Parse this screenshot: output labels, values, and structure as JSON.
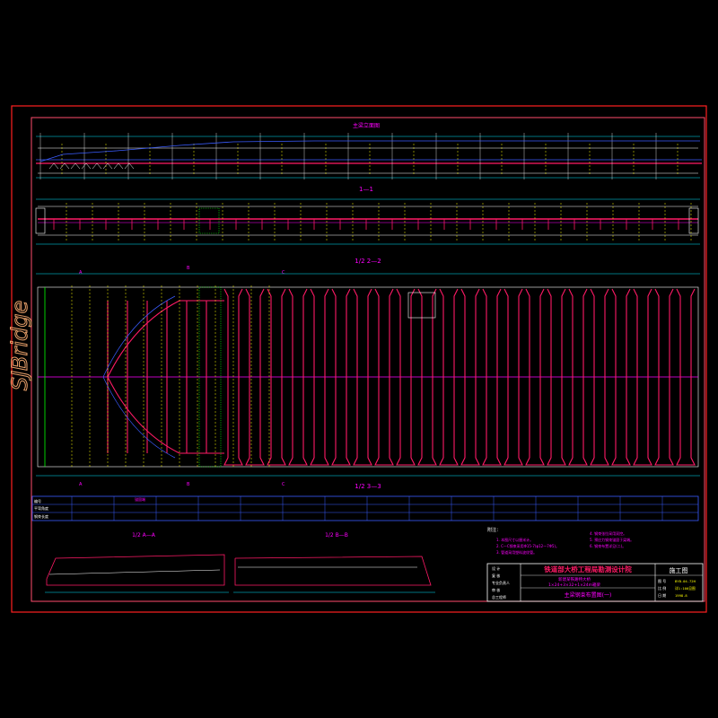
{
  "colors": {
    "background": "#000000",
    "border": "#ff2020",
    "frame_inner": "#ff4d6d",
    "cyan": "#00e5ff",
    "blue": "#3a5cff",
    "magenta": "#ff00ff",
    "pink": "#ff1a66",
    "green": "#00ff00",
    "yellow": "#ffff00",
    "white": "#ffffff",
    "watermark": "#e8a06a"
  },
  "watermark": "SJBridge",
  "sections": {
    "top_title": "主梁立面图",
    "middle_title": "1—1",
    "plan_title": "1/2 2—2",
    "plan_subtitle": "1/2 3—3",
    "section_aa": "1/2 A—A",
    "section_bb": "1/2 B—B"
  },
  "markers": {
    "a_top": "A",
    "b_top": "B",
    "c_top": "C",
    "a_bot": "A",
    "b_bot": "B",
    "c_bot": "C"
  },
  "title_block": {
    "institute": "铁道部大桥工程局勘测设计院",
    "project_line1": "新建某铁路特大桥",
    "project_line2": "1×24+3×32+1×24m箱梁",
    "drawing_name": "主梁钢束布置图(一)",
    "stage": "施工图",
    "row_labels": [
      "设 计",
      "复 核",
      "专业负责人",
      "审 核",
      "总工程师"
    ],
    "info_labels": [
      "图 号",
      "比 例",
      "日 期"
    ],
    "info_values": [
      "BYB-04-72H",
      "详1:100见图",
      "1998.8"
    ]
  },
  "notes": {
    "heading": "附注：",
    "left": [
      "1. 本图尺寸以厘米计。",
      "2. C—C钢束采用Φ15-7(φ12—7Φ5)。",
      "3. 管道采用塑料波纹管。"
    ],
    "right": [
      "4. 钢束张拉采用双控。",
      "5. 预应力钢束锚固于梁端。",
      "6. 钢束布置详见(二)。"
    ]
  },
  "table_labels": [
    "编号",
    "平弯角度",
    "钢束长度"
  ],
  "table_header_mark": "锚固端"
}
